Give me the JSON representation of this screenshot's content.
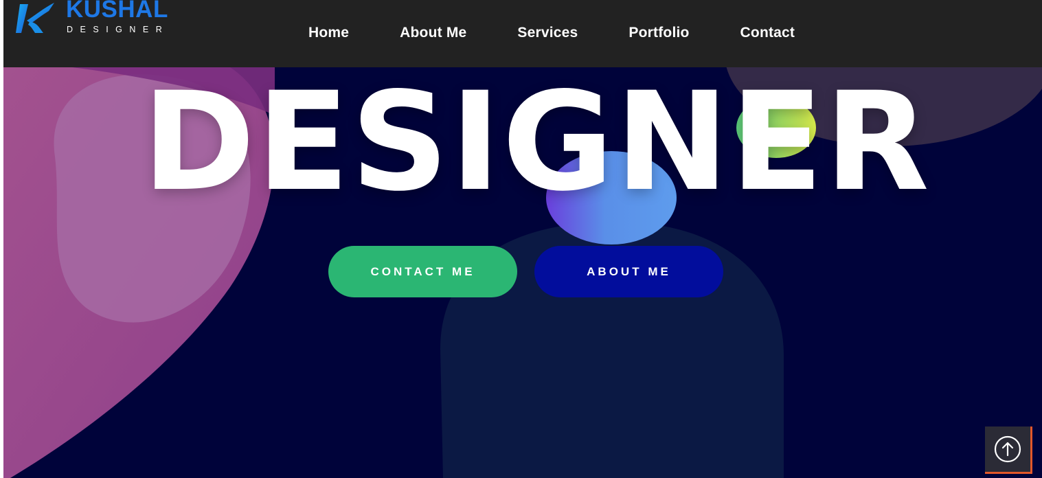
{
  "brand": {
    "name": "KUSHAL",
    "tagline": "DESIGNER",
    "primary_color": "#1e78e6"
  },
  "nav": {
    "items": [
      {
        "label": "Home"
      },
      {
        "label": "About Me"
      },
      {
        "label": "Services"
      },
      {
        "label": "Portfolio"
      },
      {
        "label": "Contact"
      }
    ]
  },
  "hero": {
    "title": "DESIGNER",
    "background_color": "#00033a",
    "buttons": {
      "contact_label": "CONTACT ME",
      "about_label": "ABOUT ME"
    }
  },
  "colors": {
    "navbar": "#222222",
    "contact_button": "#2bb673",
    "about_button": "#020d9c",
    "scroll_accent": "#e2582a"
  },
  "icons": {
    "scroll_top": "arrow-up-circle-icon",
    "logo": "k-logo-icon"
  }
}
